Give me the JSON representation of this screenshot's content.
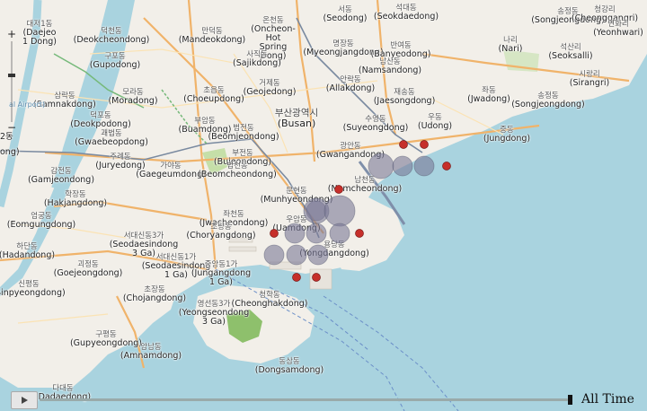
{
  "colors": {
    "water": "#a9d3df",
    "land": "#f2efe9",
    "park": "#8ec06c",
    "major_road": "#f0b36a",
    "rail": "#7a8aa0",
    "bubble_large": "#7a7896",
    "bubble_small": "#c62f2a"
  },
  "map": {
    "labels": [
      {
        "ko": "대저1동",
        "en": "(Daejeo\n1 Dong)"
      },
      {
        "ko": "덕천동",
        "en": "(Deokcheondong)"
      },
      {
        "ko": "만덕동",
        "en": "(Mandeokdong)"
      },
      {
        "ko": "온천동",
        "en": "(Oncheon-\nHot\nSpring\nDong)"
      },
      {
        "ko": "서동",
        "en": "(Seodong)"
      },
      {
        "ko": "석대동",
        "en": "(Seokdaedong)"
      },
      {
        "ko": "송정동",
        "en": "(Songjeongdong)"
      },
      {
        "ko": "청강리",
        "en": "(Cheonggangri)"
      },
      {
        "ko": "연화리",
        "en": "(Yeonhwari)"
      },
      {
        "ko": "구포동",
        "en": "(Gupodong)"
      },
      {
        "ko": "명장동",
        "en": "(Myeongjangdong)"
      },
      {
        "ko": "반여동",
        "en": "(Banyeodong)"
      },
      {
        "ko": "남산동",
        "en": "(Namsandong)"
      },
      {
        "ko": "나리",
        "en": "(Nari)"
      },
      {
        "ko": "석산리",
        "en": "(Seoksalli)"
      },
      {
        "ko": "사직동",
        "en": "(Sajikdong)"
      },
      {
        "ko": "모라동",
        "en": "(Moradong)"
      },
      {
        "ko": "거제동",
        "en": "(Geojedong)"
      },
      {
        "ko": "안락동",
        "en": "(Allakdong)"
      },
      {
        "ko": "시랑리",
        "en": "(Sirangri)"
      },
      {
        "ko": "삼락동",
        "en": "(Samnakdong)"
      },
      {
        "ko": "초읍동",
        "en": "(Choeupdong)"
      },
      {
        "ko": "재송동",
        "en": "(Jaesongdong)"
      },
      {
        "ko": "좌동",
        "en": "(Jwadong)"
      },
      {
        "ko": "송정동",
        "en": "(Songjeongdong)"
      },
      {
        "ko": "덕포동",
        "en": "(Deokpodong)"
      },
      {
        "ko": "부암동",
        "en": "(Buamdong)"
      },
      {
        "ko": "부산광역시",
        "en": "(Busan)",
        "big": true
      },
      {
        "ko": "수영동",
        "en": "(Suyeongdong)"
      },
      {
        "ko": "우동",
        "en": "(Udong)"
      },
      {
        "ko": "괘법동",
        "en": "(Gwaebeopdong)"
      },
      {
        "ko": "범전동",
        "en": "(Beomjeondong)"
      },
      {
        "ko": "중동",
        "en": "(Jungdong)"
      },
      {
        "ko": "광안동",
        "en": "(Gwangandong)"
      },
      {
        "ko": "주례동",
        "en": "(Juryedong)"
      },
      {
        "ko": "가야동",
        "en": "(Gaegeumdong)"
      },
      {
        "ko": "부전동",
        "en": "(Bujeondong)"
      },
      {
        "ko": "감전동",
        "en": "(Gamjeondong)"
      },
      {
        "ko": "범천동",
        "en": "(Beomcheondong)"
      },
      {
        "ko": "남천동",
        "en": "(Namcheondong)"
      },
      {
        "ko": "문현동",
        "en": "(Munhyeondong)"
      },
      {
        "ko": "학장동",
        "en": "(Hakjangdong)"
      },
      {
        "ko": "좌천동",
        "en": "(Jwacheondong)"
      },
      {
        "ko": "엄궁동",
        "en": "(Eomgungdong)"
      },
      {
        "ko": "우암동",
        "en": "(Uamdong)"
      },
      {
        "ko": "초량동",
        "en": "(Choryangdong)"
      },
      {
        "ko": "하단동",
        "en": "(Hadandong)"
      },
      {
        "ko": "서대신동3가",
        "en": "(Seodaesindong\n3 Ga)"
      },
      {
        "ko": "용당동",
        "en": "(Yongdangdong)"
      },
      {
        "ko": "괴정동",
        "en": "(Goejeongdong)"
      },
      {
        "ko": "서대신동1가",
        "en": "(Seodaesindong\n1 Ga)"
      },
      {
        "ko": "중앙동1가",
        "en": "(Jungangdong\n1 Ga)"
      },
      {
        "ko": "신평동",
        "en": "(Sinpyeongdong)"
      },
      {
        "ko": "청학동",
        "en": "(Cheonghakdong)"
      },
      {
        "ko": "초장동",
        "en": "(Chojangdong)"
      },
      {
        "ko": "영선동3가",
        "en": "(Yeongseondong\n3 Ga)"
      },
      {
        "ko": "구평동",
        "en": "(Gupyeongdong)"
      },
      {
        "ko": "암남동",
        "en": "(Amnamdong)"
      },
      {
        "ko": "동삼동",
        "en": "(Dongsamdong)"
      },
      {
        "ko": "다대동",
        "en": "(Dadaedong)"
      }
    ],
    "overlay_left_text": [
      "al Airport)",
      "2동",
      "ong)"
    ]
  },
  "points": [
    {
      "kind": "large",
      "size": 3
    },
    {
      "kind": "large",
      "size": 2
    },
    {
      "kind": "large",
      "size": 2
    },
    {
      "kind": "large",
      "size": 2
    },
    {
      "kind": "large",
      "size": 3
    },
    {
      "kind": "large",
      "size": 4
    },
    {
      "kind": "large",
      "size": 2
    },
    {
      "kind": "large",
      "size": 2
    },
    {
      "kind": "large",
      "size": 2
    },
    {
      "kind": "large",
      "size": 2
    },
    {
      "kind": "large",
      "size": 2
    },
    {
      "kind": "large",
      "size": 2
    },
    {
      "kind": "small",
      "size": 1
    },
    {
      "kind": "small",
      "size": 1
    },
    {
      "kind": "small",
      "size": 1
    },
    {
      "kind": "small",
      "size": 1
    },
    {
      "kind": "small",
      "size": 1
    },
    {
      "kind": "small",
      "size": 1
    },
    {
      "kind": "small",
      "size": 1
    },
    {
      "kind": "small",
      "size": 1
    }
  ],
  "zoom": {
    "plus": "+",
    "minus": "−",
    "level": 0.4
  },
  "timeline": {
    "label": "All Time",
    "progress": 1.0
  }
}
